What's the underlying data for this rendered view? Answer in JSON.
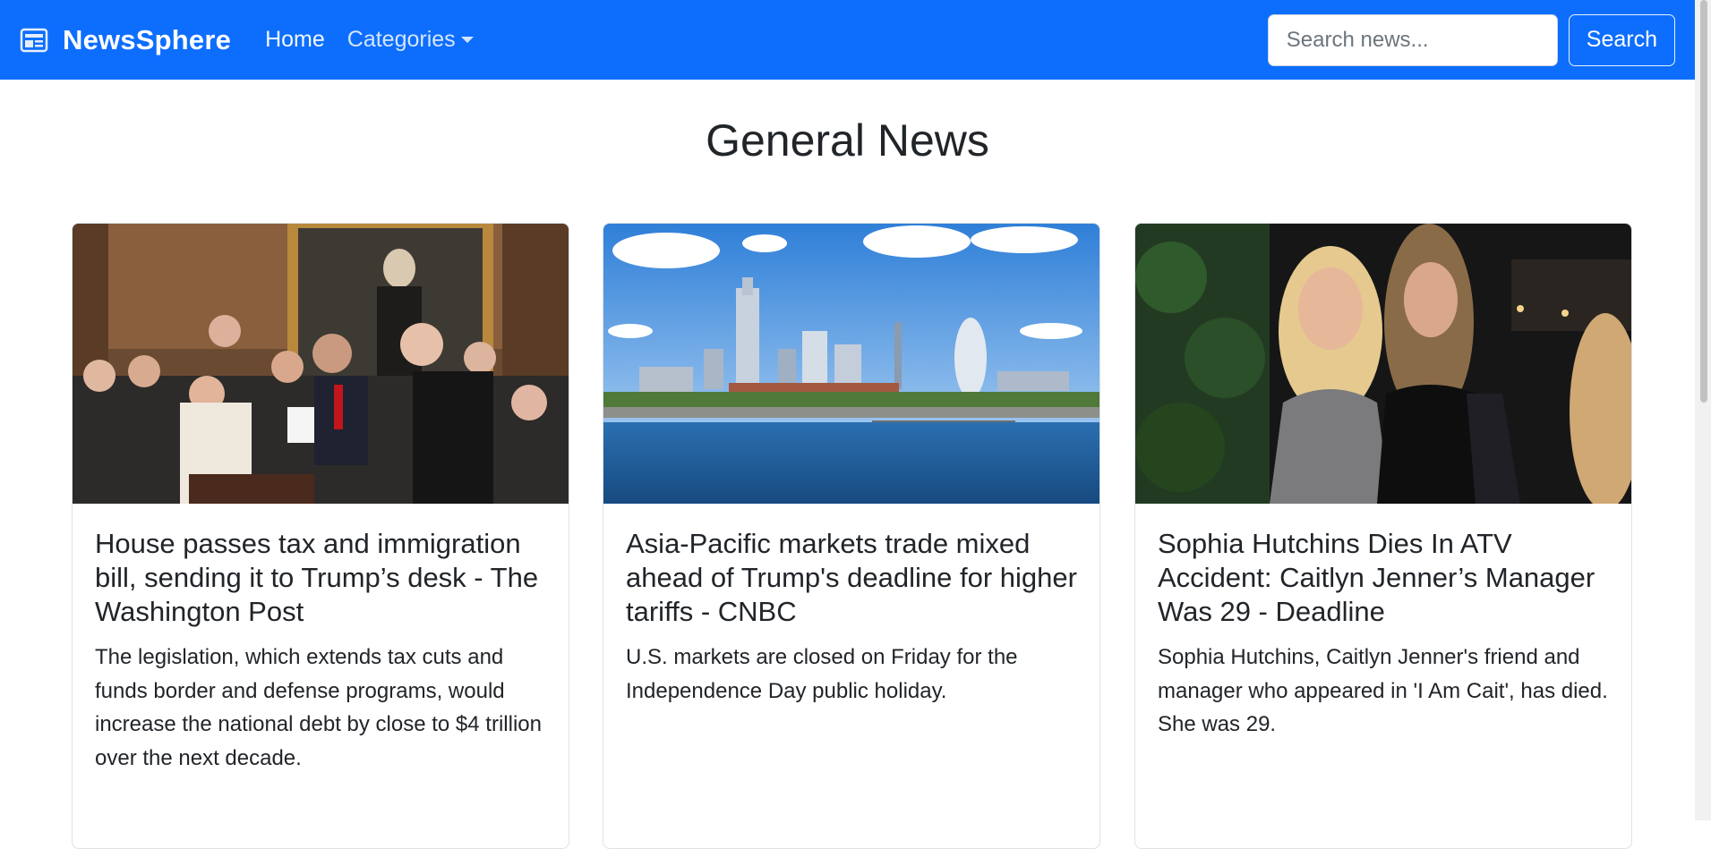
{
  "navbar": {
    "brand": "NewsSphere",
    "brand_icon": "newspaper-icon",
    "links": [
      {
        "label": "Home"
      },
      {
        "label": "Categories"
      }
    ],
    "search_placeholder": "Search news...",
    "search_button": "Search",
    "colors": {
      "primary": "#0d6efd",
      "text": "#ffffff"
    }
  },
  "page": {
    "title": "General News"
  },
  "articles": [
    {
      "title": "House passes tax and immigration bill, sending it to Trump’s desk - The Washington Post",
      "description": "The legislation, which extends tax cuts and funds border and defense programs, would increase the national debt by close to $4 trillion over the next decade."
    },
    {
      "title": "Asia-Pacific markets trade mixed ahead of Trump's deadline for higher tariffs - CNBC",
      "description": "U.S. markets are closed on Friday for the Independence Day public holiday."
    },
    {
      "title": "Sophia Hutchins Dies In ATV Accident: Caitlyn Jenner’s Manager Was 29 - Deadline",
      "description": "Sophia Hutchins, Caitlyn Jenner's friend and manager who appeared in 'I Am Cait', has died. She was 29."
    }
  ]
}
